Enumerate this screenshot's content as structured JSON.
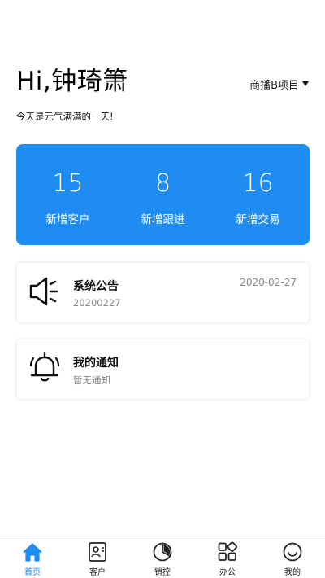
{
  "header": {
    "greeting": "Hi,钟琦箫",
    "project_selector": "商播B项目"
  },
  "subtitle": "今天是元气满满的一天!",
  "colors": {
    "accent": "#1e8cf1",
    "card_text": "#ffffff",
    "muted": "#888888"
  },
  "stats": [
    {
      "value": "15",
      "label": "新增客户"
    },
    {
      "value": "8",
      "label": "新增跟进"
    },
    {
      "value": "16",
      "label": "新增交易"
    }
  ],
  "announcement": {
    "icon": "speaker-icon",
    "title": "系统公告",
    "subtitle": "20200227",
    "date": "2020-02-27"
  },
  "notification": {
    "icon": "bell-icon",
    "title": "我的通知",
    "subtitle": "暂无通知"
  },
  "tabbar": {
    "active": "home",
    "items": [
      {
        "id": "home",
        "label": "首页",
        "icon": "home-icon"
      },
      {
        "id": "customers",
        "label": "客户",
        "icon": "contact-card-icon"
      },
      {
        "id": "sales",
        "label": "销控",
        "icon": "pie-chart-icon"
      },
      {
        "id": "office",
        "label": "办公",
        "icon": "apps-grid-icon"
      },
      {
        "id": "mine",
        "label": "我的",
        "icon": "smile-face-icon"
      }
    ]
  }
}
